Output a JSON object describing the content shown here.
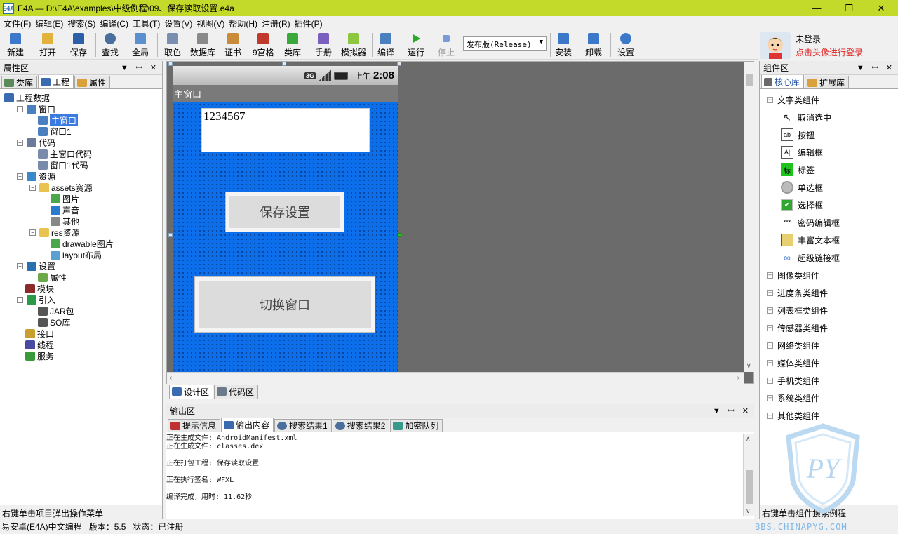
{
  "window": {
    "app_icon": "E4A",
    "title": "E4A — D:\\E4A\\examples\\中级例程\\09、保存读取设置.e4a",
    "minimize_icon": "—",
    "restore_icon": "❐",
    "close_icon": "✕"
  },
  "menu": [
    "文件(F)",
    "编辑(E)",
    "搜索(S)",
    "编译(C)",
    "工具(T)",
    "设置(V)",
    "视图(V)",
    "帮助(H)",
    "注册(R)",
    "插件(P)"
  ],
  "toolbar": {
    "buttons": [
      {
        "label": "新建",
        "icon": "new-file-icon",
        "color": "#3b78c9"
      },
      {
        "label": "打开",
        "icon": "open-folder-icon",
        "color": "#e2b33a"
      },
      {
        "label": "保存",
        "icon": "save-icon",
        "color": "#2d5fa8"
      },
      {
        "label": "查找",
        "icon": "search-icon",
        "color": "#4a6f9c"
      },
      {
        "label": "全局",
        "icon": "global-icon",
        "color": "#5b8fd0"
      },
      {
        "label": "取色",
        "icon": "color-picker-icon",
        "color": "#7a8fb0"
      },
      {
        "label": "数据库",
        "icon": "database-icon",
        "color": "#8a8a8a"
      },
      {
        "label": "证书",
        "icon": "certificate-icon",
        "color": "#c98a3a"
      },
      {
        "label": "9宫格",
        "icon": "nine-grid-icon",
        "color": "#c0392b"
      },
      {
        "label": "类库",
        "icon": "library-icon",
        "color": "#3aa83a"
      },
      {
        "label": "手册",
        "icon": "manual-icon",
        "color": "#7a5fc0"
      },
      {
        "label": "模拟器",
        "icon": "android-emulator-icon",
        "color": "#8dc63f"
      },
      {
        "label": "编译",
        "icon": "compile-icon",
        "color": "#4a7fc0"
      },
      {
        "label": "运行",
        "icon": "run-icon",
        "color": "#2ea82e"
      },
      {
        "label": "停止",
        "icon": "stop-icon",
        "color": "#7a9ad8"
      },
      {
        "label": "安装",
        "icon": "install-icon",
        "color": "#3b78c9"
      },
      {
        "label": "卸载",
        "icon": "uninstall-icon",
        "color": "#3b78c9"
      },
      {
        "label": "设置",
        "icon": "settings-info-icon",
        "color": "#3b78c9"
      }
    ],
    "build_mode": "发布版(Release)"
  },
  "user": {
    "status": "未登录",
    "login_hint": "点击头像进行登录"
  },
  "left_panel": {
    "title": "属性区",
    "tabs": [
      "类库",
      "工程",
      "属性"
    ],
    "active_tab": "工程",
    "tree": [
      {
        "label": "工程数据",
        "icon": "project-icon",
        "depth": 0
      },
      {
        "label": "窗口",
        "icon": "window-icon",
        "depth": 1
      },
      {
        "label": "主窗口",
        "icon": "window-icon",
        "depth": 2,
        "selected": true
      },
      {
        "label": "窗口1",
        "icon": "window-icon",
        "depth": 2
      },
      {
        "label": "代码",
        "icon": "code-icon",
        "depth": 1
      },
      {
        "label": "主窗口代码",
        "icon": "code-file-icon",
        "depth": 2
      },
      {
        "label": "窗口1代码",
        "icon": "code-file-icon",
        "depth": 2
      },
      {
        "label": "资源",
        "icon": "resource-icon",
        "depth": 1
      },
      {
        "label": "assets资源",
        "icon": "folder-icon",
        "depth": 2
      },
      {
        "label": "图片",
        "icon": "image-icon",
        "depth": 3
      },
      {
        "label": "声音",
        "icon": "sound-icon",
        "depth": 3
      },
      {
        "label": "其他",
        "icon": "other-icon",
        "depth": 3
      },
      {
        "label": "res资源",
        "icon": "folder-icon",
        "depth": 2
      },
      {
        "label": "drawable图片",
        "icon": "image-icon",
        "depth": 3
      },
      {
        "label": "layout布局",
        "icon": "layout-icon",
        "depth": 3
      },
      {
        "label": "设置",
        "icon": "info-icon",
        "depth": 1
      },
      {
        "label": "属性",
        "icon": "gear-icon",
        "depth": 2
      },
      {
        "label": "模块",
        "icon": "module-icon",
        "depth": 1
      },
      {
        "label": "引入",
        "icon": "import-icon",
        "depth": 1
      },
      {
        "label": "JAR包",
        "icon": "jar-icon",
        "depth": 2
      },
      {
        "label": "SO库",
        "icon": "so-icon",
        "depth": 2
      },
      {
        "label": "接口",
        "icon": "interface-icon",
        "depth": 1
      },
      {
        "label": "线程",
        "icon": "thread-icon",
        "depth": 1
      },
      {
        "label": "服务",
        "icon": "service-icon",
        "depth": 1
      }
    ],
    "status": "右键单击项目弹出操作菜单"
  },
  "designer": {
    "phone": {
      "network": "3G",
      "am_pm": "上午",
      "time": "2:08",
      "window_title": "主窗口",
      "edit_text": "1234567",
      "button1": "保存设置",
      "button2": "切换窗口"
    },
    "tabs": [
      "设计区",
      "代码区"
    ],
    "active_tab": "设计区"
  },
  "output": {
    "title": "输出区",
    "tabs": [
      "提示信息",
      "输出内容",
      "搜索结果1",
      "搜索结果2",
      "加密队列"
    ],
    "active_tab": "输出内容",
    "lines": [
      "正在生成文件: AndroidManifest.xml",
      "正在生成文件: classes.dex",
      "",
      "正在打包工程: 保存读取设置",
      "",
      "正在执行签名: WFXL",
      "",
      "编译完成，用时: 11.62秒"
    ]
  },
  "right_panel": {
    "title": "组件区",
    "tabs": [
      "核心库",
      "扩展库"
    ],
    "active_tab": "核心库",
    "group": "文字类组件",
    "items": [
      {
        "label": "取消选中",
        "icon": "cursor-icon"
      },
      {
        "label": "按钮",
        "icon": "button-icon"
      },
      {
        "label": "编辑框",
        "icon": "editbox-icon"
      },
      {
        "label": "标签",
        "icon": "label-icon"
      },
      {
        "label": "单选框",
        "icon": "radio-icon"
      },
      {
        "label": "选择框",
        "icon": "checkbox-icon"
      },
      {
        "label": "密码编辑框",
        "icon": "password-icon"
      },
      {
        "label": "丰富文本框",
        "icon": "richtext-icon"
      },
      {
        "label": "超级链接框",
        "icon": "link-icon"
      }
    ],
    "collapsed_groups": [
      "图像类组件",
      "进度条类组件",
      "列表框类组件",
      "传感器类组件",
      "网络类组件",
      "媒体类组件",
      "手机类组件",
      "系统类组件",
      "其他类组件"
    ],
    "status": "右键单击组件搜索例程"
  },
  "bottom": {
    "product": "易安卓(E4A)中文编程",
    "version": "版本：5.5",
    "state": "状态：已注册"
  },
  "watermark": {
    "logo_text": "PY",
    "site": "BBS.CHINAPYG.COM"
  }
}
